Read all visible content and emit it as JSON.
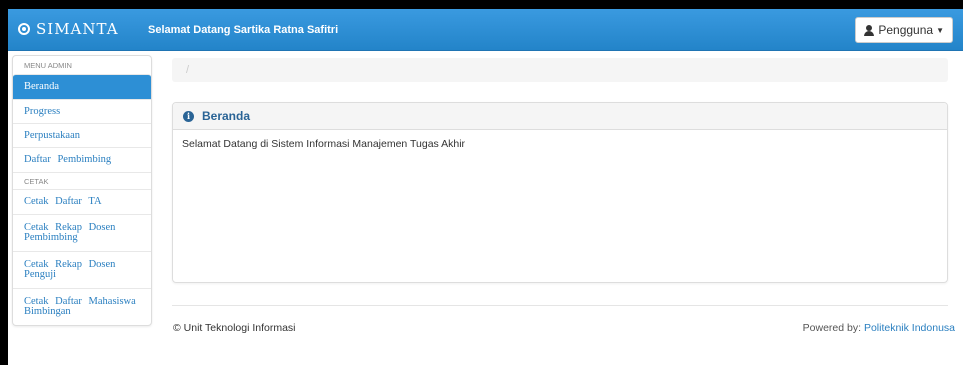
{
  "navbar": {
    "brand": "SIMANTA",
    "welcome": "Selamat Datang Sartika Ratna Safitri",
    "user_menu": "Pengguna",
    "brand_color": "#2d8fd5"
  },
  "sidebar": {
    "header": "MENU ADMIN",
    "items": [
      {
        "label": "Beranda",
        "active": true
      },
      {
        "label": "Progress"
      },
      {
        "label": "Perpustakaan"
      },
      {
        "label": "Daftar Pembimbing"
      }
    ],
    "subheader": "CETAK",
    "print_items": [
      {
        "label": "Cetak Daftar TA"
      },
      {
        "label": "Cetak Rekap Dosen Pembimbing"
      },
      {
        "label": "Cetak Rekap Dosen Penguji"
      },
      {
        "label": "Cetak Daftar Mahasiswa Bimbingan"
      }
    ]
  },
  "breadcrumb": {
    "separator": "/"
  },
  "panel": {
    "icon": "info-icon",
    "title": "Beranda",
    "body": "Selamat Datang di Sistem Informasi Manajemen Tugas Akhir"
  },
  "footer": {
    "copyright": "© Unit Teknologi Informasi",
    "powered_prefix": "Powered by:",
    "powered_link": "Politeknik Indonusa"
  }
}
